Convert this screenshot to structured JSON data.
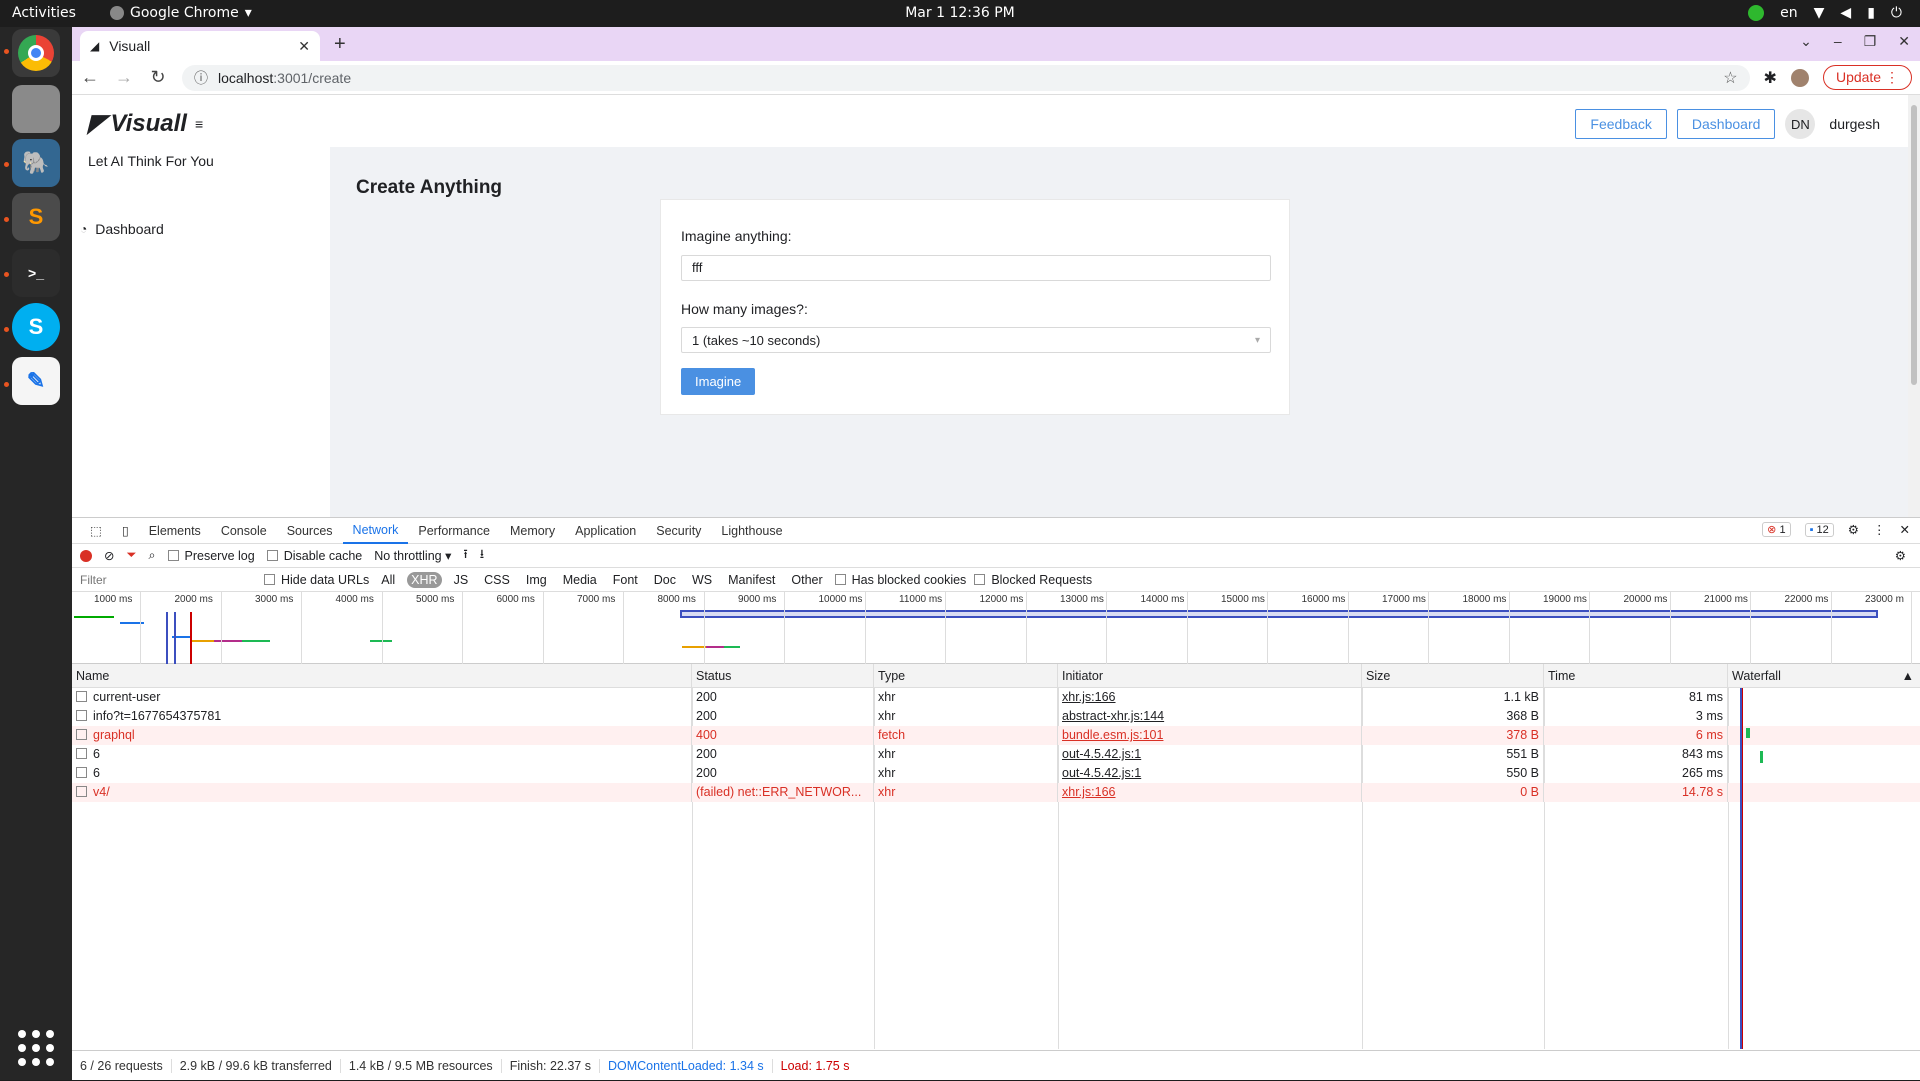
{
  "os": {
    "activities": "Activities",
    "app_name": "Google Chrome",
    "clock": "Mar 1  12:36 PM",
    "lang": "en"
  },
  "browser": {
    "tab_title": "Visuall",
    "url_host": "localhost",
    "url_path": ":3001/create",
    "update_label": "Update"
  },
  "app": {
    "logo_text": "Visuall",
    "tagline": "Let AI Think For You",
    "sidebar_item": "Dashboard",
    "header": {
      "feedback": "Feedback",
      "dashboard": "Dashboard",
      "avatar_initials": "DN",
      "username": "durgesh"
    },
    "page_title": "Create Anything",
    "form": {
      "prompt_label": "Imagine anything",
      "prompt_value": "fff",
      "count_label": "How many images?",
      "count_value": "1 (takes ~10 seconds)",
      "submit": "Imagine"
    }
  },
  "devtools": {
    "tabs": [
      "Elements",
      "Console",
      "Sources",
      "Network",
      "Performance",
      "Memory",
      "Application",
      "Security",
      "Lighthouse"
    ],
    "error_count": "1",
    "message_count": "12",
    "toolbar": {
      "preserve_log": "Preserve log",
      "disable_cache": "Disable cache",
      "throttling": "No throttling"
    },
    "filter": {
      "placeholder": "Filter",
      "hide_data_urls": "Hide data URLs",
      "types": [
        "All",
        "XHR",
        "JS",
        "CSS",
        "Img",
        "Media",
        "Font",
        "Doc",
        "WS",
        "Manifest",
        "Other"
      ],
      "has_blocked_cookies": "Has blocked cookies",
      "blocked_requests": "Blocked Requests"
    },
    "overview_ticks": [
      "1000 ms",
      "2000 ms",
      "3000 ms",
      "4000 ms",
      "5000 ms",
      "6000 ms",
      "7000 ms",
      "8000 ms",
      "9000 ms",
      "10000 ms",
      "11000 ms",
      "12000 ms",
      "13000 ms",
      "14000 ms",
      "15000 ms",
      "16000 ms",
      "17000 ms",
      "18000 ms",
      "19000 ms",
      "20000 ms",
      "21000 ms",
      "22000 ms",
      "23000 m"
    ],
    "columns": [
      "Name",
      "Status",
      "Type",
      "Initiator",
      "Size",
      "Time",
      "Waterfall"
    ],
    "rows": [
      {
        "name": "current-user",
        "status": "200",
        "type": "xhr",
        "initiator": "xhr.js:166",
        "size": "1.1 kB",
        "time": "81 ms",
        "error": false
      },
      {
        "name": "info?t=1677654375781",
        "status": "200",
        "type": "xhr",
        "initiator": "abstract-xhr.js:144",
        "size": "368 B",
        "time": "3 ms",
        "error": false
      },
      {
        "name": "graphql",
        "status": "400",
        "type": "fetch",
        "initiator": "bundle.esm.js:101",
        "size": "378 B",
        "time": "6 ms",
        "error": true
      },
      {
        "name": "6",
        "status": "200",
        "type": "xhr",
        "initiator": "out-4.5.42.js:1",
        "size": "551 B",
        "time": "843 ms",
        "error": false
      },
      {
        "name": "6",
        "status": "200",
        "type": "xhr",
        "initiator": "out-4.5.42.js:1",
        "size": "550 B",
        "time": "265 ms",
        "error": false
      },
      {
        "name": "v4/",
        "status": "(failed) net::ERR_NETWOR...",
        "type": "xhr",
        "initiator": "xhr.js:166",
        "size": "0 B",
        "time": "14.78 s",
        "error": true
      }
    ],
    "status": {
      "requests": "6 / 26 requests",
      "transferred": "2.9 kB / 99.6 kB transferred",
      "resources": "1.4 kB / 9.5 MB resources",
      "finish": "Finish: 22.37 s",
      "dcl": "DOMContentLoaded: 1.34 s",
      "load": "Load: 1.75 s"
    }
  }
}
